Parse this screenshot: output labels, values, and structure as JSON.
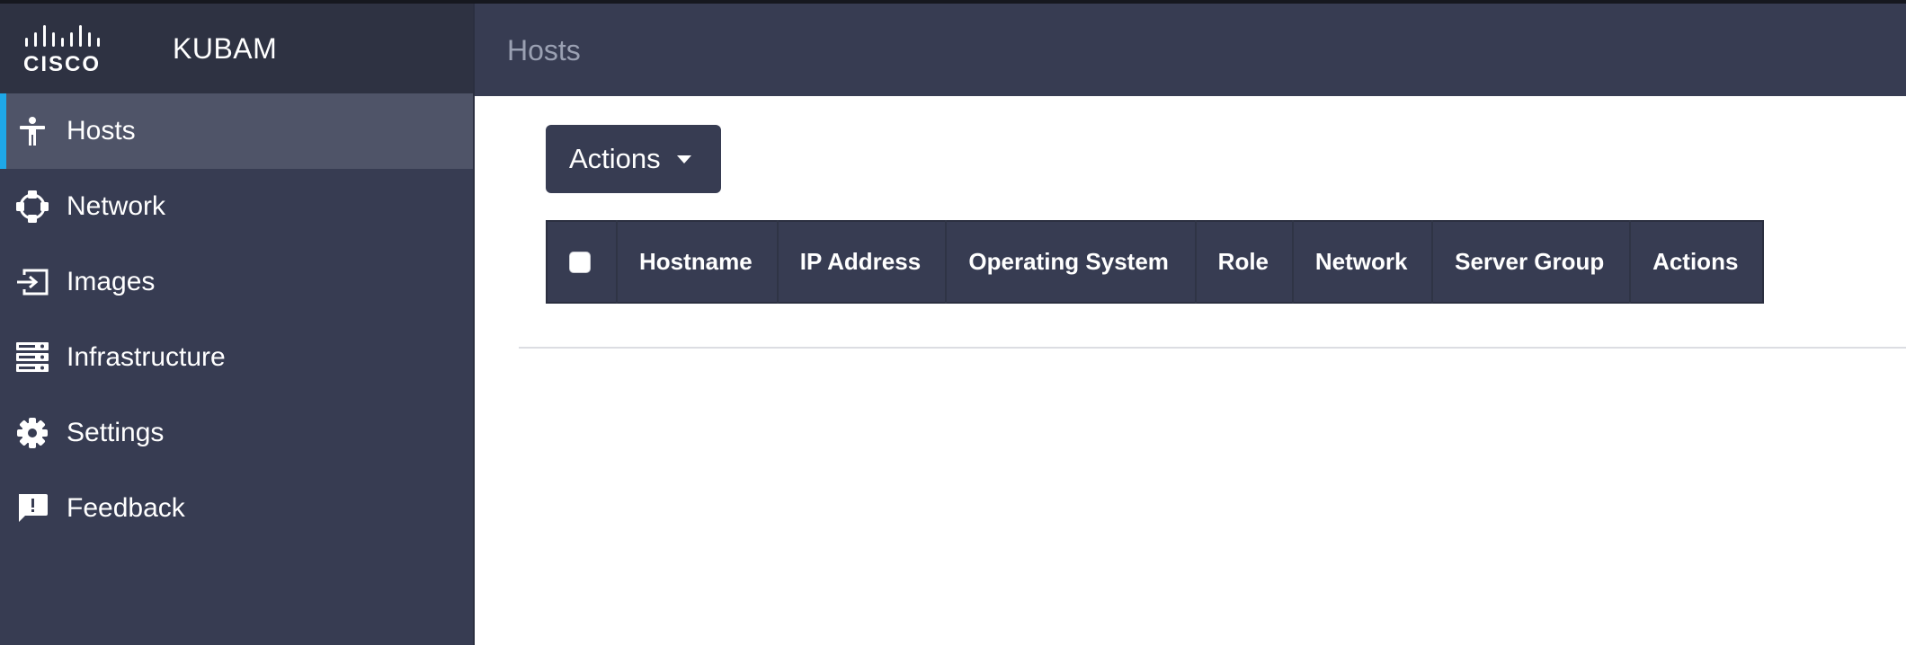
{
  "brand": {
    "logo_text": "CISCO",
    "app_name": "KUBAM"
  },
  "sidebar": {
    "items": [
      {
        "label": "Hosts",
        "icon": "person-icon",
        "active": true
      },
      {
        "label": "Network",
        "icon": "network-icon",
        "active": false
      },
      {
        "label": "Images",
        "icon": "import-icon",
        "active": false
      },
      {
        "label": "Infrastructure",
        "icon": "server-rack-icon",
        "active": false
      },
      {
        "label": "Settings",
        "icon": "gear-icon",
        "active": false
      },
      {
        "label": "Feedback",
        "icon": "feedback-icon",
        "active": false
      }
    ]
  },
  "header": {
    "title": "Hosts"
  },
  "toolbar": {
    "actions_label": "Actions"
  },
  "table": {
    "columns": [
      "Hostname",
      "IP Address",
      "Operating System",
      "Role",
      "Network",
      "Server Group",
      "Actions"
    ],
    "rows": []
  },
  "colors": {
    "sidebar_bg": "#373c52",
    "brand_bg": "#2e3242",
    "active_item_bg": "#4f5468",
    "accent": "#1ea8e8",
    "header_title": "#9aa0b2"
  }
}
